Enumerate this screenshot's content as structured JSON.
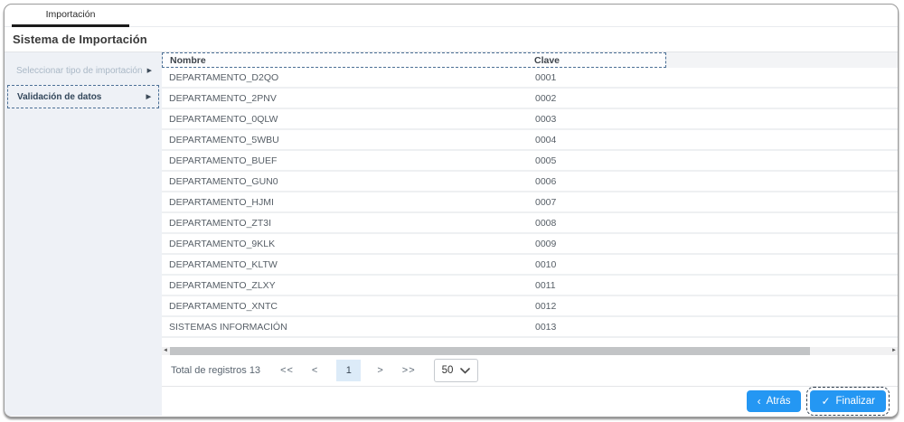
{
  "tabs": [
    {
      "label": "Importación",
      "active": true
    }
  ],
  "page_title": "Sistema de Importación",
  "sidebar": {
    "items": [
      {
        "label": "Seleccionar tipo de importación",
        "state": "disabled",
        "arrow_icon": "▶"
      },
      {
        "label": "Validación de datos",
        "state": "active",
        "arrow_icon": "▶"
      }
    ]
  },
  "table": {
    "columns": {
      "nombre": "Nombre",
      "clave": "Clave"
    },
    "rows": [
      {
        "nombre": "DEPARTAMENTO_D2QO",
        "clave": "0001"
      },
      {
        "nombre": "DEPARTAMENTO_2PNV",
        "clave": "0002"
      },
      {
        "nombre": "DEPARTAMENTO_0QLW",
        "clave": "0003"
      },
      {
        "nombre": "DEPARTAMENTO_5WBU",
        "clave": "0004"
      },
      {
        "nombre": "DEPARTAMENTO_BUEF",
        "clave": "0005"
      },
      {
        "nombre": "DEPARTAMENTO_GUN0",
        "clave": "0006"
      },
      {
        "nombre": "DEPARTAMENTO_HJMI",
        "clave": "0007"
      },
      {
        "nombre": "DEPARTAMENTO_ZT3I",
        "clave": "0008"
      },
      {
        "nombre": "DEPARTAMENTO_9KLK",
        "clave": "0009"
      },
      {
        "nombre": "DEPARTAMENTO_KLTW",
        "clave": "0010"
      },
      {
        "nombre": "DEPARTAMENTO_ZLXY",
        "clave": "0011"
      },
      {
        "nombre": "DEPARTAMENTO_XNTC",
        "clave": "0012"
      },
      {
        "nombre": "SISTEMAS INFORMACIÓN",
        "clave": "0013"
      }
    ]
  },
  "scrollbar": {
    "left_arrow_icon": "◄",
    "right_arrow_icon": "►"
  },
  "pagination": {
    "total_label": "Total de registros 13",
    "first_label": "<<",
    "prev_label": "<",
    "current_page": "1",
    "next_label": ">",
    "last_label": ">>",
    "page_size": "50"
  },
  "footer": {
    "back_label": "Atrás",
    "back_icon": "‹",
    "finish_label": "Finalizar",
    "finish_icon": "✓"
  },
  "colors": {
    "accent_blue": "#2497f3",
    "focus_dashed": "#4c7096",
    "sidebar_bg": "#eef1f6",
    "active_page_bg": "#dcebf8",
    "active_tab_underline": "#1b1b1b"
  }
}
